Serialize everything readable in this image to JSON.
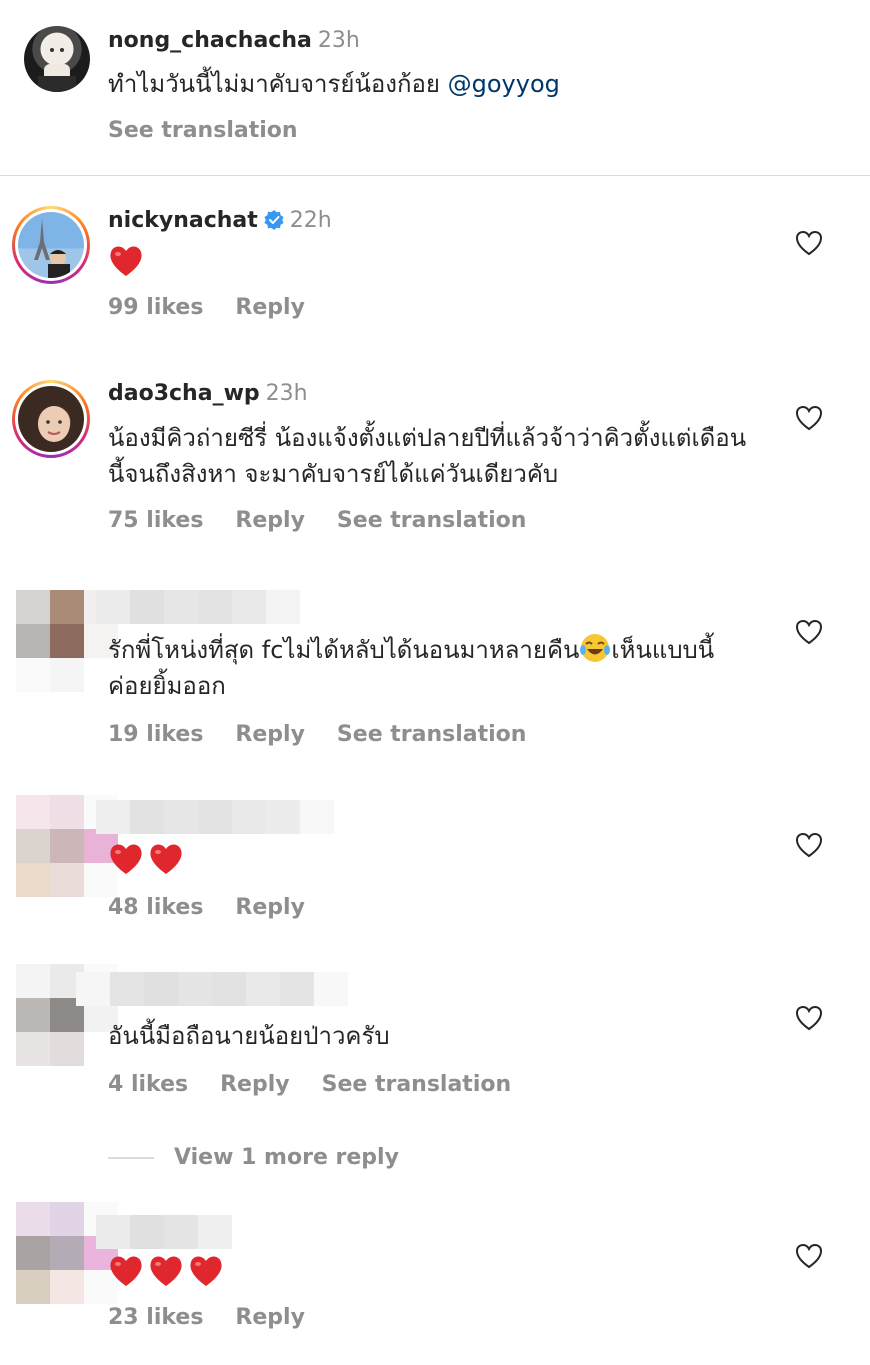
{
  "comments": [
    {
      "username": "nong_chachacha",
      "time": "23h",
      "text": "ทำไมวันนี้ไม่มาคับจารย์น้องก้อย",
      "mention": "@goyyog",
      "translate": "See translation"
    },
    {
      "username": "nickynachat",
      "time": "22h",
      "verified": true,
      "likes": "99 likes",
      "reply": "Reply"
    },
    {
      "username": "dao3cha_wp",
      "time": "23h",
      "text": "น้องมีคิวถ่ายซีรี่ น้องแจ้งตั้งแต่ปลายปีที่แล้วจ้าว่าคิวตั้งแต่เดือนนี้จนถึงสิงหา จะมาคับจารย์ได้แค่วันเดียวคับ",
      "likes": "75 likes",
      "reply": "Reply",
      "translate": "See translation"
    },
    {
      "text_a": "รักพี่โหน่งที่สุด fcไม่ได้หลับได้นอนมาหลายคืน",
      "text_b": "เห็นแบบนี้ค่อยยิ้มออก",
      "likes": "19 likes",
      "reply": "Reply",
      "translate": "See translation"
    },
    {
      "likes": "48 likes",
      "reply": "Reply"
    },
    {
      "text": "อันนี้มือถือนายน้อยป่าวครับ",
      "likes": "4 likes",
      "reply": "Reply",
      "translate": "See translation"
    },
    {
      "likes": "23 likes",
      "reply": "Reply"
    }
  ],
  "view_more": "View 1 more reply",
  "icons": {
    "like": "heart-outline-icon",
    "verified": "verified-badge-icon",
    "emoji_heart": "red-heart-emoji",
    "emoji_laugh": "tears-of-joy-emoji"
  },
  "colors": {
    "text": "#262626",
    "muted": "#8e8e8e",
    "mention": "#00376b",
    "verified": "#3897f0",
    "heart": "#e0272d"
  }
}
